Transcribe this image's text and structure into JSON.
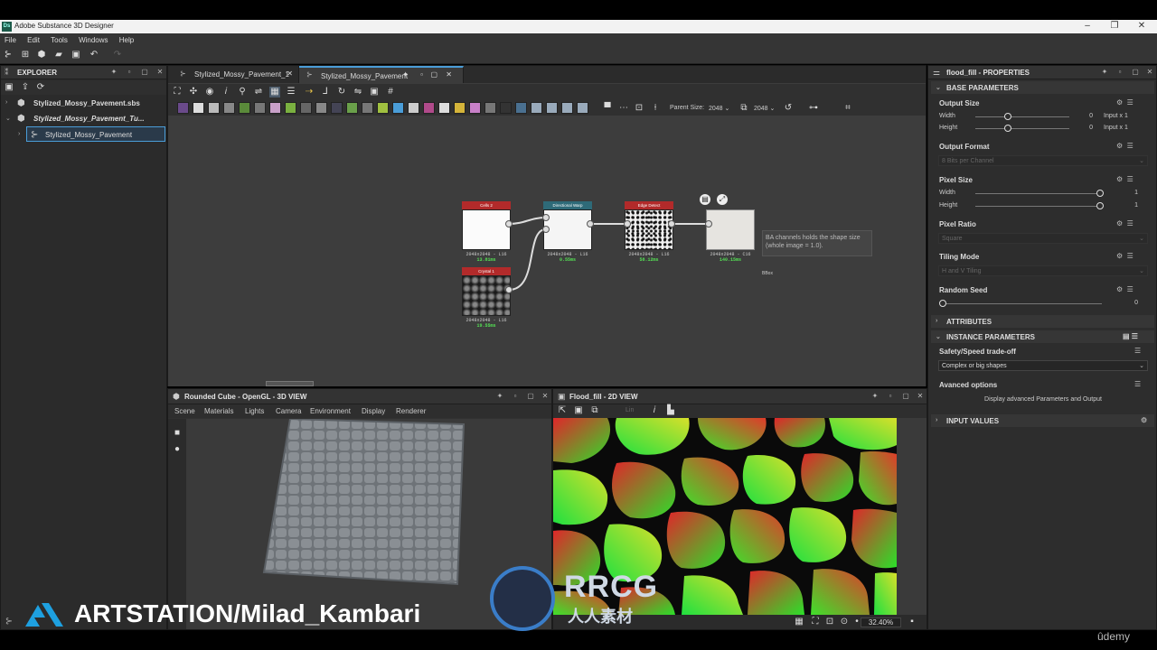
{
  "app": {
    "title": "Adobe Substance 3D Designer",
    "icon": "Ds"
  },
  "menu": [
    "File",
    "Edit",
    "Tools",
    "Windows",
    "Help"
  ],
  "explorer": {
    "title": "EXPLORER",
    "items": [
      {
        "label": "Stylized_Mossy_Pavement.sbs",
        "expanded": false
      },
      {
        "label": "Stylized_Mossy_Pavement_Tu...",
        "expanded": true
      },
      {
        "label": "Stylized_Mossy_Pavement",
        "selected": true
      }
    ]
  },
  "graph": {
    "tabs": [
      {
        "label": "Stylized_Mossy_Pavement_1",
        "active": false
      },
      {
        "label": "Stylized_Mossy_Pavement",
        "active": true
      }
    ],
    "parent_size_label": "Parent Size:",
    "parent_size_value": "2048",
    "size_value": "2048",
    "nodes": [
      {
        "name": "Cells 2",
        "res": "2048x2048 - L16",
        "time": "13.81ms",
        "color": "#b22a2a"
      },
      {
        "name": "Directional Warp",
        "res": "2048x2048 - L16",
        "time": "0.55ms",
        "color": "#2e6a78"
      },
      {
        "name": "Edge Detect",
        "res": "2048x2048 - L16",
        "time": "58.12ms",
        "color": "#b22a2a"
      },
      {
        "name": "",
        "res": "2048x2048 - C16",
        "time": "140.15ms",
        "color": "#444"
      },
      {
        "name": "Crystal 1",
        "res": "2048x2048 - L16",
        "time": "19.55ms",
        "color": "#b22a2a"
      }
    ],
    "output_label": "BBox",
    "tooltip": "BA channels holds the shape size (whole image = 1.0)."
  },
  "view3d": {
    "title": "Rounded Cube - OpenGL - 3D VIEW",
    "menu": [
      "Scene",
      "Materials",
      "Lights",
      "Camera",
      "Environment",
      "Display",
      "Renderer"
    ]
  },
  "view2d": {
    "title": "Flood_fill - 2D VIEW",
    "channel": "Lin",
    "zoom": "32.40%"
  },
  "properties": {
    "title": "flood_fill - PROPERTIES",
    "base_parameters": "BASE PARAMETERS",
    "output_size": {
      "label": "Output Size",
      "width_label": "Width",
      "width_value": "0",
      "width_mode": "Input x 1",
      "height_label": "Height",
      "height_value": "0",
      "height_mode": "Input x 1"
    },
    "output_format": {
      "label": "Output Format",
      "value": "8 Bits per Channel"
    },
    "pixel_size": {
      "label": "Pixel Size",
      "width_label": "Width",
      "width_value": "1",
      "height_label": "Height",
      "height_value": "1"
    },
    "pixel_ratio": {
      "label": "Pixel Ratio",
      "value": "Square"
    },
    "tiling_mode": {
      "label": "Tiling Mode",
      "value": "H and V Tiling"
    },
    "random_seed": {
      "label": "Random Seed",
      "value": "0"
    },
    "attributes": "ATTRIBUTES",
    "instance_parameters": "INSTANCE PARAMETERS",
    "safety": {
      "label": "Safety/Speed trade-off",
      "value": "Complex or big shapes"
    },
    "advanced": {
      "label": "Avanced options",
      "button": "Display advanced Parameters and Output"
    },
    "input_values": "INPUT VALUES"
  },
  "watermarks": {
    "artstation": "ARTSTATION/Milad_Kambari",
    "rrcg": "RRCG",
    "rrcg_sub": "人人素材",
    "udemy": "ûdemy"
  }
}
